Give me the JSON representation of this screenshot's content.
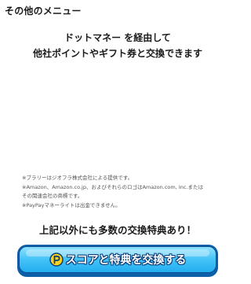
{
  "section_title": "その他のメニュー",
  "intro": {
    "line1": "ドットマネー を経由して",
    "line2": "他社ポイントやギフト券と交換できます"
  },
  "notes": [
    "※ブラリーはジオフラ株式会社による提供です。",
    "※Amazon、Amazon.co.jp、およびそれらのロゴはAmazon.com, Inc.または",
    "その関連会社の商標です。",
    "※PayPayマネーライトは出金できません。"
  ],
  "promo_text": "上記以外にも多数の交換特典あり！",
  "cta": {
    "label": "スコアと特典を交換する",
    "icon": "coin-p-icon"
  },
  "colors": {
    "cta_light": "#8fe2ff",
    "cta_mid": "#45c3f7",
    "cta_dark": "#22aef0",
    "cta_border": "#0b4f92",
    "icon_yellow": "#ffd21a"
  }
}
